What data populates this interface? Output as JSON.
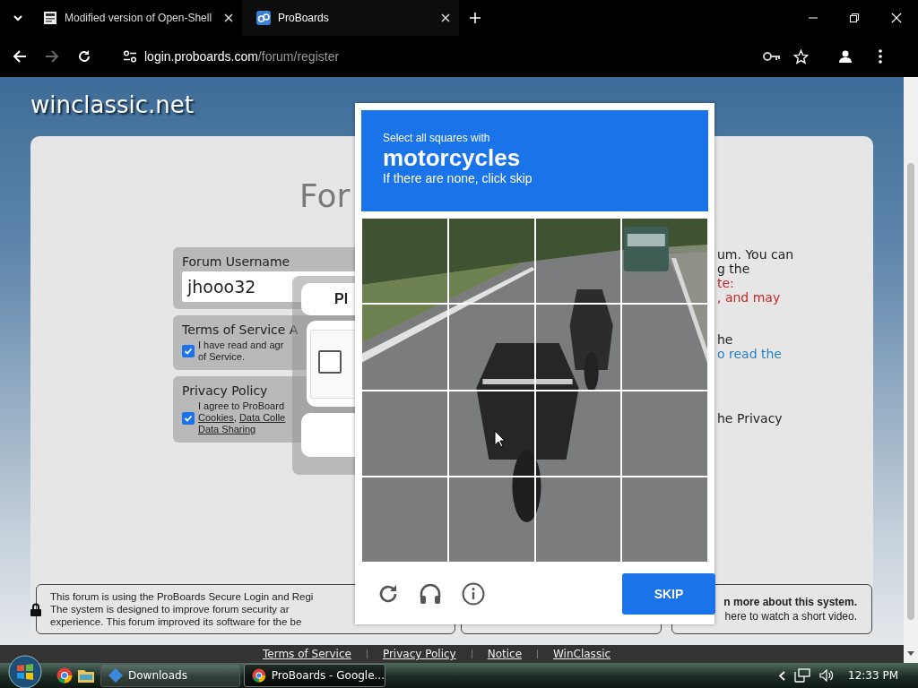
{
  "browser": {
    "tabs": [
      {
        "title": "Modified version of Open-Shell",
        "kind": "doc",
        "selected": false
      },
      {
        "title": "ProBoards",
        "kind": "proboards",
        "selected": true
      }
    ],
    "url": {
      "host": "login.proboards.com",
      "path": "/forum/register"
    },
    "forward_disabled": true
  },
  "site": {
    "logo": "winclassic.net",
    "page_title": "For"
  },
  "form": {
    "username": {
      "label": "Forum Username",
      "value": "jhooo32"
    },
    "terms": {
      "label": "Terms of Service A",
      "lines": [
        "I have read and agr",
        "of Service."
      ],
      "checked": true
    },
    "privacy": {
      "label": "Privacy Policy",
      "checked": true,
      "lines": [
        [
          {
            "text": "I agree to ProBoard",
            "link": false
          }
        ],
        [
          {
            "text": "Cookies",
            "link": true
          },
          {
            "text": ", ",
            "link": false
          },
          {
            "text": "Data Colle",
            "link": true
          }
        ],
        [
          {
            "text": "Data Sharing",
            "link": true
          }
        ]
      ]
    }
  },
  "anchor": {
    "title": "Pl",
    "checked": false
  },
  "notes": [
    {
      "lines": [
        {
          "text": "um. You can",
          "color": "#222222"
        },
        {
          "text": "g the",
          "color": "#222222"
        },
        {
          "text": "te:",
          "color": "#c8262b"
        },
        {
          "text": ", and may",
          "color": "#c8262b"
        }
      ]
    },
    {
      "lines": [
        {
          "text": "he",
          "color": "#222222"
        },
        {
          "text": "o read the",
          "color": "#2a7fc1"
        }
      ]
    },
    {
      "lines": [
        {
          "text": "he Privacy",
          "color": "#222222"
        }
      ]
    }
  ],
  "info_box": {
    "lines": [
      "This forum is using the ProBoards Secure Login and Regi",
      "The system is designed to improve forum security ar",
      "experience. This forum improved its software for the be"
    ]
  },
  "video_box": {
    "lines": [
      {
        "text": "n more about this system.",
        "bold": true
      },
      {
        "text": "here to watch a short video.",
        "bold": false
      }
    ]
  },
  "footer_links": [
    "Terms of Service",
    "Privacy Policy",
    "Notice",
    "WinClassic"
  ],
  "captcha": {
    "prompt": "Select all squares with",
    "target": "motorcycles",
    "hint": "If there are none, click skip",
    "tiles": [
      {
        "selected": false
      },
      {
        "selected": false
      },
      {
        "selected": false
      },
      {
        "selected": false
      },
      {
        "selected": false
      },
      {
        "selected": false
      },
      {
        "selected": false
      },
      {
        "selected": false
      },
      {
        "selected": false
      },
      {
        "selected": false
      },
      {
        "selected": false
      },
      {
        "selected": false
      },
      {
        "selected": false
      },
      {
        "selected": false
      },
      {
        "selected": false
      },
      {
        "selected": false
      }
    ],
    "button": "SKIP"
  },
  "taskbar": {
    "buttons": [
      {
        "label": "Downloads",
        "kind": "folder",
        "selected": false
      },
      {
        "label": "ProBoards - Google...",
        "kind": "chrome",
        "selected": true
      }
    ],
    "clock": "12:33 PM"
  }
}
